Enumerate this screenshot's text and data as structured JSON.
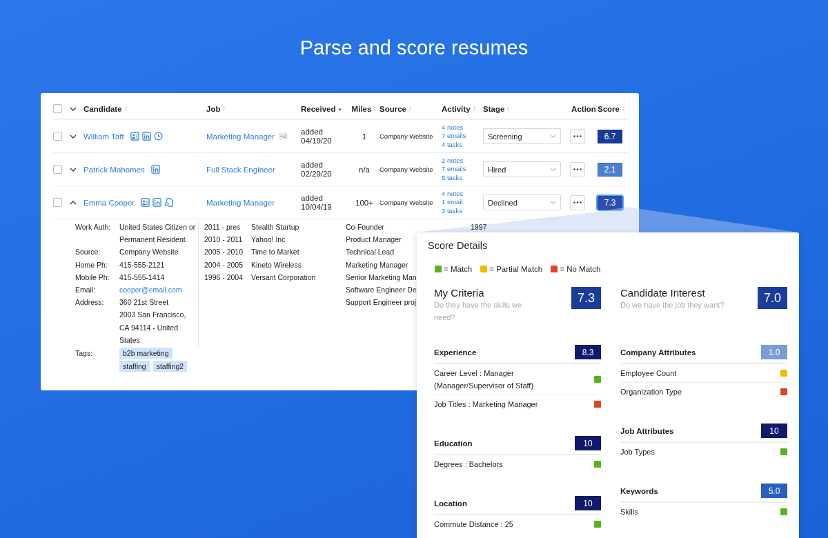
{
  "heading": "Parse and score resumes",
  "table": {
    "select_all": {
      "checked": false
    },
    "expand_all": {
      "expanded": false
    },
    "columns": [
      {
        "label": "Candidate",
        "sortable": true,
        "sorted_desc": false
      },
      {
        "label": "Job",
        "sortable": true,
        "sorted_desc": false
      },
      {
        "label": "Received",
        "sortable": true,
        "sorted_desc": true
      },
      {
        "label": "Miles",
        "sortable": true,
        "sorted_desc": false
      },
      {
        "label": "Source",
        "sortable": true,
        "sorted_desc": false
      },
      {
        "label": "Activity",
        "sortable": true,
        "sorted_desc": false
      },
      {
        "label": "Stage",
        "sortable": true,
        "sorted_desc": false
      },
      {
        "label": "Action",
        "sortable": false
      },
      {
        "label": "Score",
        "sortable": true,
        "sorted_desc": false
      }
    ],
    "rows": [
      {
        "checked": false,
        "expanded": false,
        "name": "William Taft",
        "icons": [
          {
            "kind": "profile"
          },
          {
            "kind": "linkedin"
          },
          {
            "kind": "clock"
          }
        ],
        "job": "Marketing Manager",
        "job_extra": "+2",
        "received_label": "added",
        "received_date": "04/19/20",
        "miles": "1",
        "source": "Company Website",
        "activity": [
          "4 notes",
          "7 emails",
          "4 tasks"
        ],
        "stage": "Screening",
        "score": "6.7",
        "color": "#173a9b",
        "selected": false
      },
      {
        "checked": false,
        "expanded": false,
        "name": "Patrick Mahomes",
        "icons": [
          {
            "kind": "linkedin"
          }
        ],
        "job": "Full Stack Engineer",
        "received_label": "added",
        "received_date": "02/29/20",
        "miles": "n/a",
        "source": "Company Website",
        "activity": [
          "2 notes",
          "7 emails",
          "5 tasks"
        ],
        "stage": "Hired",
        "score": "2.1",
        "color": "#4d7fd2",
        "selected": false
      },
      {
        "checked": false,
        "expanded": true,
        "name": "Emma Cooper",
        "icons": [
          {
            "kind": "profile"
          },
          {
            "kind": "linkedin"
          },
          {
            "kind": "document"
          }
        ],
        "job": "Marketing Manager",
        "received_label": "added",
        "received_date": "10/04/19",
        "miles": "100+",
        "source": "Company Website",
        "activity": [
          "4 notes",
          "1 email",
          "3 tasks"
        ],
        "stage": "Declined",
        "score": "7.3",
        "color": "#2b4fb0",
        "selected": true
      }
    ],
    "details": {
      "fields": [
        {
          "label": "Work Auth:",
          "values": [
            "United States Citizen or Permanent Resident"
          ]
        },
        {
          "label": "Source:",
          "values": [
            "Company Website"
          ]
        },
        {
          "label": "Home Ph:",
          "values": [
            "415-555-2121"
          ]
        },
        {
          "label": "Mobile Ph:",
          "values": [
            "415-555-1414"
          ]
        },
        {
          "label": "Email:",
          "values": [
            "cooper@email.com"
          ],
          "kind": "link"
        },
        {
          "label": "Address:",
          "values": [
            "360 21st Street",
            "2003 San Francisco, CA 94114 - United States"
          ]
        }
      ],
      "tags_label": "Tags:",
      "tags": [
        "b2b marketing",
        "staffing",
        "staffing2"
      ],
      "experience": [
        {
          "years": "2011 - pres",
          "company": "Stealth Startup",
          "title": "Co-Founder",
          "column_4": "1997"
        },
        {
          "years": "2010 - 2011",
          "company": "Yahoo! Inc",
          "title": "Product Manager"
        },
        {
          "years": "2005 - 2010",
          "company": "Time to Market",
          "title": "Technical Lead"
        },
        {
          "years": "2004 - 2005",
          "company": "Kineto Wireless",
          "title": "Marketing Manager"
        },
        {
          "years": "1996 - 2004",
          "company": "Versant Corporation",
          "title": "Senior Marketing Man"
        },
        {
          "title": "Software Engineer De"
        },
        {
          "title": "Support Engineer proj"
        }
      ]
    }
  },
  "score_details": {
    "title": "Score Details",
    "legend": [
      {
        "label": "= Match",
        "color": "#5ab31e"
      },
      {
        "label": "= Partial Match",
        "color": "#f8b800"
      },
      {
        "label": "= No Match",
        "color": "#de4420"
      }
    ],
    "panels": [
      {
        "title": "My Criteria",
        "subtitle": "Do they have the skills we need?",
        "score": "7.3",
        "color": "#1b3d9a",
        "sections": [
          {
            "title": "Experience",
            "score": "8.3",
            "color": "#11196c",
            "items": [
              {
                "label": "Career Level : Manager (Manager/Supervisor of Staff)",
                "color": "#5ab31e"
              },
              {
                "label": "Job Titles : Marketing Manager",
                "color": "#de4420"
              }
            ]
          },
          {
            "title": "Education",
            "score": "10",
            "color": "#11196c",
            "items": [
              {
                "label": "Degrees : Bachelors",
                "color": "#5ab31e"
              }
            ]
          },
          {
            "title": "Location",
            "score": "10",
            "color": "#11196c",
            "items": [
              {
                "label": "Commute Distance : 25",
                "color": "#5ab31e"
              }
            ]
          }
        ]
      },
      {
        "title": "Candidate Interest",
        "subtitle": "Do we have the job they want?",
        "score": "7.0",
        "color": "#1b3d9a",
        "sections": [
          {
            "title": "Company Attributes",
            "score": "1.0",
            "color": "#7b9bd6",
            "items": [
              {
                "label": "Employee Count",
                "color": "#f8b800"
              },
              {
                "label": "Organization Type",
                "color": "#de4420"
              }
            ]
          },
          {
            "title": "Job Attributes",
            "score": "10",
            "color": "#11196c",
            "items": [
              {
                "label": "Job Types",
                "color": "#5ab31e"
              }
            ]
          },
          {
            "title": "Keywords",
            "score": "5.0",
            "color": "#2a5fc0",
            "items": [
              {
                "label": "Skills",
                "color": "#5ab31e"
              }
            ]
          }
        ]
      }
    ]
  }
}
